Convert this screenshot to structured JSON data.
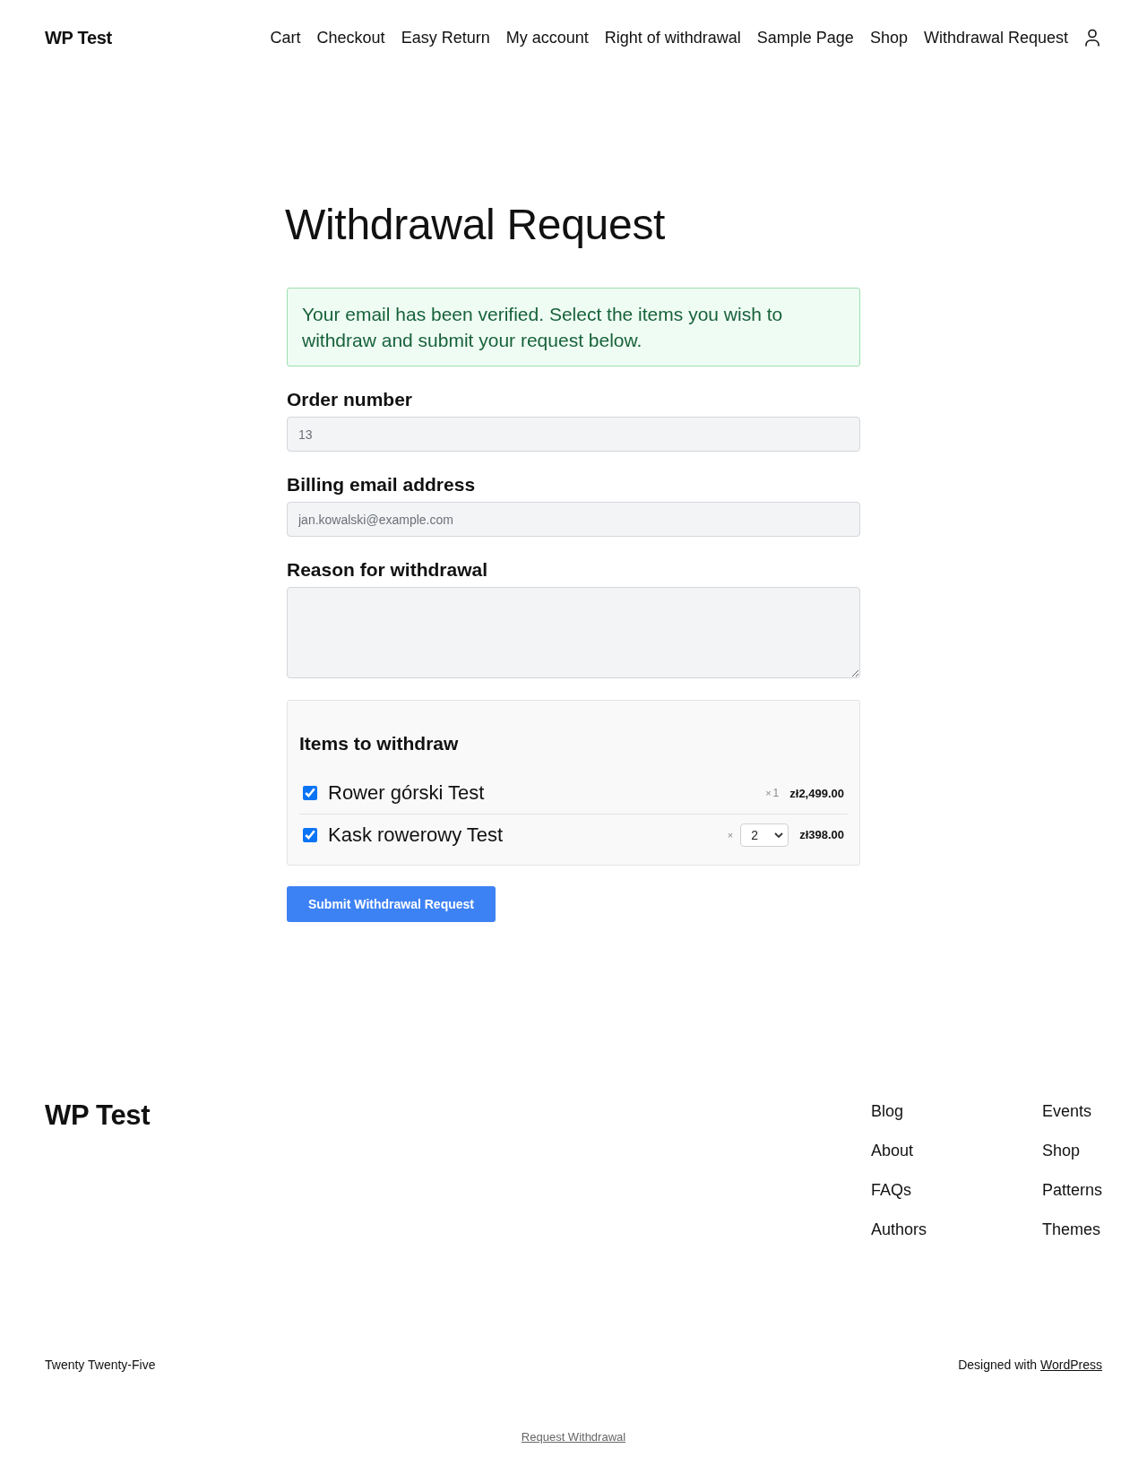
{
  "header": {
    "site_title": "WP Test",
    "nav": [
      "Cart",
      "Checkout",
      "Easy Return",
      "My account",
      "Right of withdrawal",
      "Sample Page",
      "Shop",
      "Withdrawal Request"
    ]
  },
  "page_title": "Withdrawal Request",
  "notice": {
    "text": "Your email has been verified. Select the items you wish to withdraw and submit your request below."
  },
  "fields": [
    {
      "kind": "input",
      "label": "Order number",
      "value": "13"
    },
    {
      "kind": "input",
      "label": "Billing email address",
      "value": "jan.kowalski@example.com"
    },
    {
      "kind": "textarea",
      "label": "Reason for withdrawal"
    }
  ],
  "items": {
    "title": "Items to withdraw",
    "rows": [
      {
        "kind": "fixed",
        "checked": true,
        "name": "Rower górski Test",
        "times": "×",
        "quantity": "1",
        "price": "zł2,499.00"
      },
      {
        "kind": "select",
        "checked": true,
        "name": "Kask rowerowy Test",
        "times": "×",
        "quantity": "2",
        "price": "zł398.00"
      }
    ]
  },
  "submit_button": "Submit Withdrawal Request",
  "footer": {
    "site_title": "WP Test",
    "link_columns": [
      [
        "Blog",
        "About",
        "FAQs",
        "Authors"
      ],
      [
        "Events",
        "Shop",
        "Patterns",
        "Themes"
      ]
    ],
    "theme_name": "Twenty Twenty-Five",
    "credit": {
      "text": "Designed with",
      "link": "WordPress"
    },
    "bottom_link": "Request Withdrawal"
  }
}
